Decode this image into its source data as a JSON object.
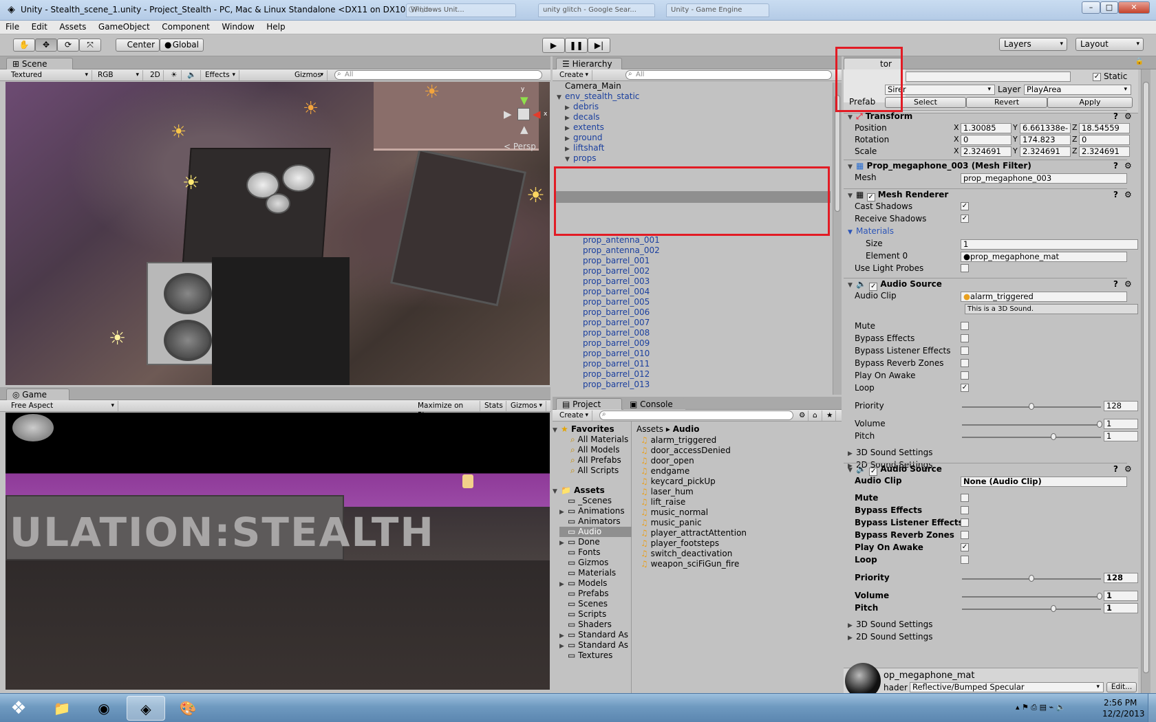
{
  "window": {
    "title": "Unity - Stealth_scene_1.unity - Project_Stealth - PC, Mac & Linux Standalone <DX11 on DX10 GPU>",
    "background_tabs": [
      "Windows Unit...",
      "unity glitch - Google Sear...",
      "Unity - Game Engine"
    ]
  },
  "menu": [
    "File",
    "Edit",
    "Assets",
    "GameObject",
    "Component",
    "Window",
    "Help"
  ],
  "toolbar": {
    "pivot": "Center",
    "space": "Global",
    "layers": "Layers",
    "layout": "Layout"
  },
  "scene": {
    "tab": "Scene",
    "shading": "Textured",
    "render": "RGB",
    "mode2d": "2D",
    "effects": "Effects",
    "gizmos": "Gizmos",
    "search_placeholder": "All",
    "persp": "Persp",
    "gizmo_y": "y",
    "gizmo_x": "x"
  },
  "game": {
    "tab": "Game",
    "aspect": "Free Aspect",
    "maximize": "Maximize on Play",
    "stats": "Stats",
    "gizmos": "Gizmos",
    "sign_text": "ULATION:STEALTH"
  },
  "hierarchy": {
    "tab": "Hierarchy",
    "create": "Create",
    "search_placeholder": "All",
    "top": [
      {
        "label": "Camera_Main",
        "depth": 0,
        "arrow": "",
        "blue": false
      },
      {
        "label": "env_stealth_static",
        "depth": 0,
        "arrow": "▼",
        "blue": true
      },
      {
        "label": "debris",
        "depth": 1,
        "arrow": "▶",
        "blue": true
      },
      {
        "label": "decals",
        "depth": 1,
        "arrow": "▶",
        "blue": true
      },
      {
        "label": "extents",
        "depth": 1,
        "arrow": "▶",
        "blue": true
      },
      {
        "label": "ground",
        "depth": 1,
        "arrow": "▶",
        "blue": true
      },
      {
        "label": "liftshaft",
        "depth": 1,
        "arrow": "▶",
        "blue": true
      },
      {
        "label": "props",
        "depth": 1,
        "arrow": "▼",
        "blue": true
      }
    ],
    "items": [
      "prop_antenna_001",
      "prop_antenna_002",
      "prop_barrel_001",
      "prop_barrel_002",
      "prop_barrel_003",
      "prop_barrel_004",
      "prop_barrel_005",
      "prop_barrel_006",
      "prop_barrel_007",
      "prop_barrel_008",
      "prop_barrel_009",
      "prop_barrel_010",
      "prop_barrel_011",
      "prop_barrel_012",
      "prop_barrel_013"
    ]
  },
  "project": {
    "tab": "Project",
    "console_tab": "Console",
    "create": "Create",
    "favorites": {
      "label": "Favorites",
      "items": [
        "All Materials",
        "All Models",
        "All Prefabs",
        "All Scripts"
      ]
    },
    "assets": {
      "label": "Assets",
      "folders": [
        {
          "label": "_Scenes",
          "arrow": ""
        },
        {
          "label": "Animations",
          "arrow": "▶"
        },
        {
          "label": "Animators",
          "arrow": ""
        },
        {
          "label": "Audio",
          "arrow": "",
          "selected": true
        },
        {
          "label": "Done",
          "arrow": "▶"
        },
        {
          "label": "Fonts",
          "arrow": ""
        },
        {
          "label": "Gizmos",
          "arrow": ""
        },
        {
          "label": "Materials",
          "arrow": ""
        },
        {
          "label": "Models",
          "arrow": "▶"
        },
        {
          "label": "Prefabs",
          "arrow": ""
        },
        {
          "label": "Scenes",
          "arrow": ""
        },
        {
          "label": "Scripts",
          "arrow": ""
        },
        {
          "label": "Shaders",
          "arrow": ""
        },
        {
          "label": "Standard As",
          "arrow": "▶"
        },
        {
          "label": "Standard As",
          "arrow": "▶"
        },
        {
          "label": "Textures",
          "arrow": ""
        }
      ]
    },
    "breadcrumb": [
      "Assets",
      "Audio"
    ],
    "files": [
      "alarm_triggered",
      "door_accessDenied",
      "door_open",
      "endgame",
      "keycard_pickUp",
      "laser_hum",
      "lift_raise",
      "music_normal",
      "music_panic",
      "player_attractAttention",
      "player_footsteps",
      "switch_deactivation",
      "weapon_sciFiGun_fire"
    ]
  },
  "inspector": {
    "tab": "Inspector",
    "tab_visible": "tor",
    "static": "Static",
    "tag_partial": "Sirer",
    "layer_label": "Layer",
    "layer_value": "PlayArea",
    "prefab": "Prefab",
    "select": "Select",
    "revert": "Revert",
    "apply": "Apply",
    "transform": {
      "title": "Transform",
      "position": {
        "label": "Position",
        "x": "1.30085",
        "y": "6.661338e-",
        "z": "18.54559"
      },
      "rotation": {
        "label": "Rotation",
        "x": "0",
        "y": "174.823",
        "z": "0"
      },
      "scale": {
        "label": "Scale",
        "x": "2.324691",
        "y": "2.324691",
        "z": "2.324691"
      }
    },
    "mesh_filter": {
      "title": "Prop_megaphone_003 (Mesh Filter)",
      "mesh_label": "Mesh",
      "mesh_value": "prop_megaphone_003"
    },
    "mesh_renderer": {
      "title": "Mesh Renderer",
      "cast": "Cast Shadows",
      "receive": "Receive Shadows",
      "materials": "Materials",
      "size_label": "Size",
      "size_value": "1",
      "element_label": "Element 0",
      "element_value": "prop_megaphone_mat",
      "probes": "Use Light Probes"
    },
    "audio1": {
      "title": "Audio Source",
      "clip_label": "Audio Clip",
      "clip_value": "alarm_triggered",
      "note": "This is a 3D Sound.",
      "mute": "Mute",
      "bypass_effects": "Bypass Effects",
      "bypass_listener": "Bypass Listener Effects",
      "bypass_reverb": "Bypass Reverb Zones",
      "play_on_awake": "Play On Awake",
      "loop": "Loop",
      "priority": {
        "label": "Priority",
        "value": "128",
        "fraction": 0.5
      },
      "volume": {
        "label": "Volume",
        "value": "1",
        "fraction": 1.0
      },
      "pitch": {
        "label": "Pitch",
        "value": "1",
        "fraction": 0.66
      },
      "sound3d": "3D Sound Settings",
      "sound2d": "2D Sound Settings"
    },
    "audio2": {
      "title": "Audio Source",
      "clip_label": "Audio Clip",
      "clip_value": "None (Audio Clip)",
      "mute": "Mute",
      "bypass_effects": "Bypass Effects",
      "bypass_listener": "Bypass Listener Effects",
      "bypass_reverb": "Bypass Reverb Zones",
      "play_on_awake": "Play On Awake",
      "loop": "Loop",
      "priority": {
        "label": "Priority",
        "value": "128",
        "fraction": 0.5
      },
      "volume": {
        "label": "Volume",
        "value": "1",
        "fraction": 1.0
      },
      "pitch": {
        "label": "Pitch",
        "value": "1",
        "fraction": 0.66
      },
      "sound3d": "3D Sound Settings",
      "sound2d": "2D Sound Settings"
    },
    "material": {
      "title": "op_megaphone_mat",
      "shader_label": "hader",
      "shader_value": "Reflective/Bumped Specular",
      "edit": "Edit..."
    }
  },
  "taskbar": {
    "time": "2:56 PM",
    "date": "12/2/2013"
  },
  "colors": {
    "highlight_box": "#e21b24",
    "hierarchy_blue": "#1a3f9e",
    "panel_bg": "#c2c2c2"
  }
}
